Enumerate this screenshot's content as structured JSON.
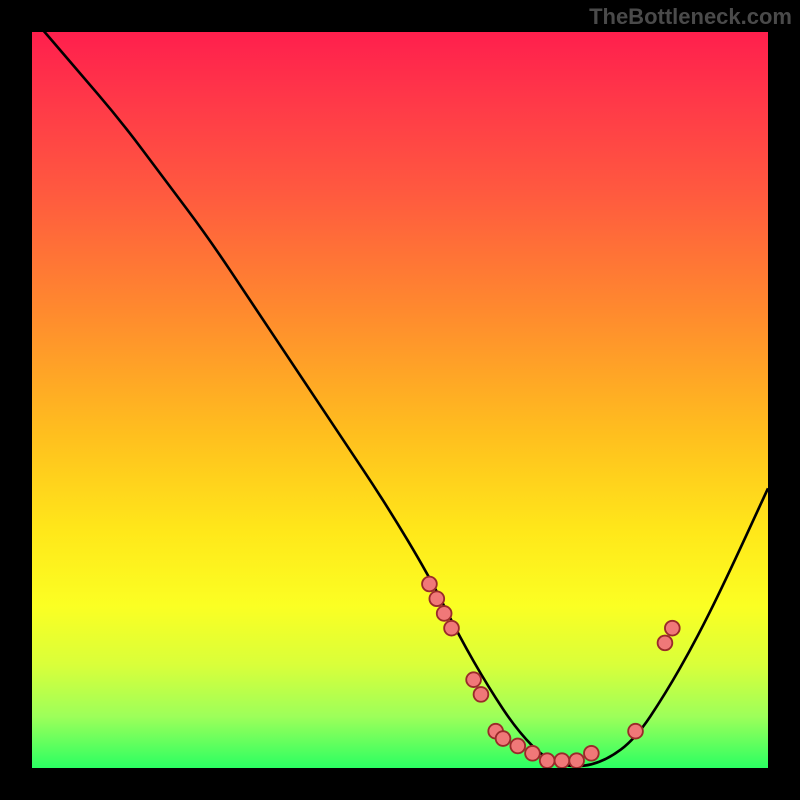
{
  "watermark": "TheBottleneck.com",
  "chart_data": {
    "type": "line",
    "title": "",
    "xlabel": "",
    "ylabel": "",
    "xlim": [
      0,
      100
    ],
    "ylim": [
      0,
      100
    ],
    "series": [
      {
        "name": "bottleneck-curve",
        "x": [
          0,
          6,
          12,
          18,
          24,
          30,
          36,
          42,
          48,
          54,
          58,
          62,
          66,
          70,
          74,
          78,
          82,
          86,
          90,
          94,
          100
        ],
        "y": [
          102,
          95,
          88,
          80,
          72,
          63,
          54,
          45,
          36,
          26,
          18,
          11,
          5,
          1,
          0,
          1,
          4,
          10,
          17,
          25,
          38
        ]
      }
    ],
    "markers": [
      {
        "label": "cluster-left-1",
        "x": 54,
        "y": 25
      },
      {
        "label": "cluster-left-2",
        "x": 55,
        "y": 23
      },
      {
        "label": "cluster-left-3",
        "x": 56,
        "y": 21
      },
      {
        "label": "cluster-left-4",
        "x": 57,
        "y": 19
      },
      {
        "label": "cluster-mid-1",
        "x": 60,
        "y": 12
      },
      {
        "label": "cluster-mid-2",
        "x": 61,
        "y": 10
      },
      {
        "label": "floor-1",
        "x": 63,
        "y": 5
      },
      {
        "label": "floor-2",
        "x": 64,
        "y": 4
      },
      {
        "label": "floor-3",
        "x": 66,
        "y": 3
      },
      {
        "label": "floor-4",
        "x": 68,
        "y": 2
      },
      {
        "label": "floor-5",
        "x": 70,
        "y": 1
      },
      {
        "label": "floor-6",
        "x": 72,
        "y": 1
      },
      {
        "label": "floor-7",
        "x": 74,
        "y": 1
      },
      {
        "label": "floor-8",
        "x": 76,
        "y": 2
      },
      {
        "label": "cluster-right-1",
        "x": 82,
        "y": 5
      },
      {
        "label": "cluster-right-2",
        "x": 86,
        "y": 17
      },
      {
        "label": "cluster-right-3",
        "x": 87,
        "y": 19
      }
    ],
    "gradient_stops": [
      {
        "pos": 0,
        "color": "#ff1f4d"
      },
      {
        "pos": 10,
        "color": "#ff3a48"
      },
      {
        "pos": 22,
        "color": "#ff5a3f"
      },
      {
        "pos": 38,
        "color": "#ff8a2e"
      },
      {
        "pos": 55,
        "color": "#ffc01e"
      },
      {
        "pos": 68,
        "color": "#ffe81a"
      },
      {
        "pos": 78,
        "color": "#fbff23"
      },
      {
        "pos": 86,
        "color": "#d9ff3a"
      },
      {
        "pos": 93,
        "color": "#9dff5a"
      },
      {
        "pos": 100,
        "color": "#2bff62"
      }
    ],
    "marker_style": {
      "fill": "#f07878",
      "stroke": "#9a2a2a",
      "r": 7
    },
    "curve_style": {
      "stroke": "#000000",
      "width": 2.5
    }
  }
}
